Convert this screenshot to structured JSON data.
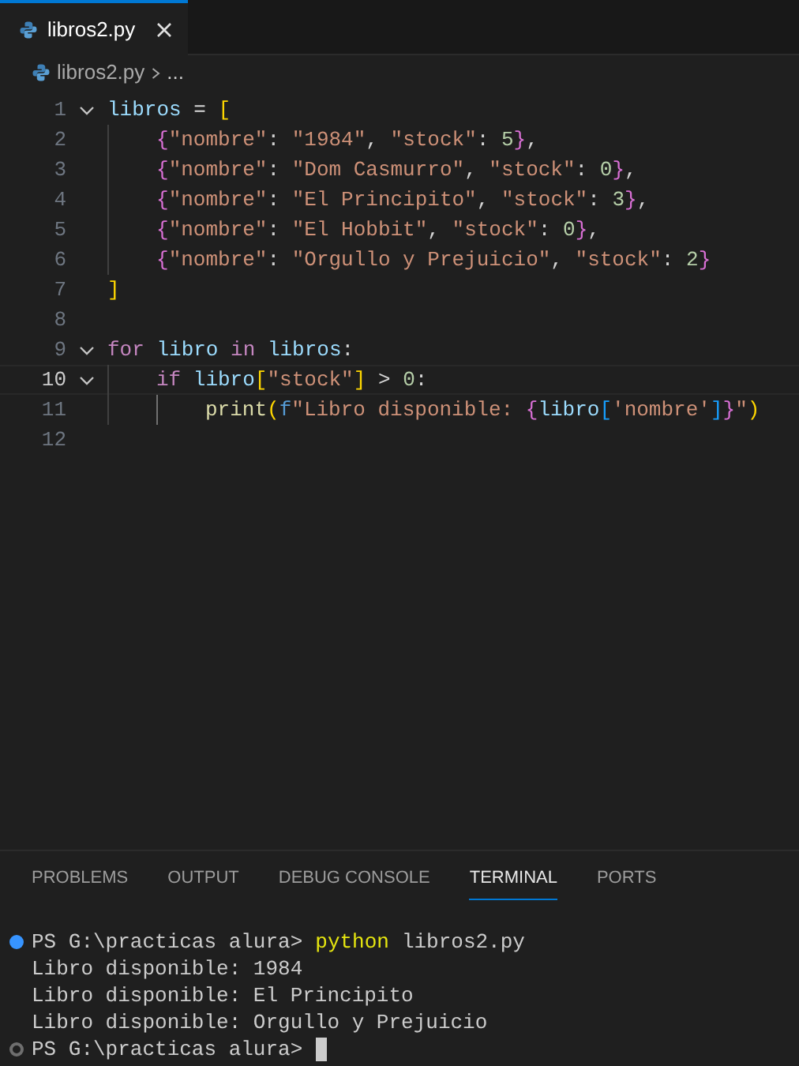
{
  "editor_tabs": [
    {
      "label": "libros2.py",
      "selected": true
    }
  ],
  "breadcrumb": {
    "file": "libros2.py",
    "symbol": "..."
  },
  "code_lines": [
    {
      "number": "1",
      "expanded": true,
      "tokens": [
        {
          "kind": "variable",
          "text": "libros"
        },
        {
          "kind": "operator",
          "text": " = "
        },
        {
          "kind": "bracket1",
          "text": "["
        }
      ],
      "children": [
        {
          "number": "2",
          "tokens": [
            {
              "kind": "bracket2",
              "text": "{"
            },
            {
              "kind": "string",
              "text": "\"nombre\""
            },
            {
              "kind": "operator",
              "text": ": "
            },
            {
              "kind": "string",
              "text": "\"1984\""
            },
            {
              "kind": "operator",
              "text": ", "
            },
            {
              "kind": "string",
              "text": "\"stock\""
            },
            {
              "kind": "operator",
              "text": ": "
            },
            {
              "kind": "number",
              "text": "5"
            },
            {
              "kind": "bracket2",
              "text": "}"
            },
            {
              "kind": "operator",
              "text": ","
            }
          ]
        },
        {
          "number": "3",
          "tokens": [
            {
              "kind": "bracket2",
              "text": "{"
            },
            {
              "kind": "string",
              "text": "\"nombre\""
            },
            {
              "kind": "operator",
              "text": ": "
            },
            {
              "kind": "string",
              "text": "\"Dom Casmurro\""
            },
            {
              "kind": "operator",
              "text": ", "
            },
            {
              "kind": "string",
              "text": "\"stock\""
            },
            {
              "kind": "operator",
              "text": ": "
            },
            {
              "kind": "number",
              "text": "0"
            },
            {
              "kind": "bracket2",
              "text": "}"
            },
            {
              "kind": "operator",
              "text": ","
            }
          ]
        },
        {
          "number": "4",
          "tokens": [
            {
              "kind": "bracket2",
              "text": "{"
            },
            {
              "kind": "string",
              "text": "\"nombre\""
            },
            {
              "kind": "operator",
              "text": ": "
            },
            {
              "kind": "string",
              "text": "\"El Principito\""
            },
            {
              "kind": "operator",
              "text": ", "
            },
            {
              "kind": "string",
              "text": "\"stock\""
            },
            {
              "kind": "operator",
              "text": ": "
            },
            {
              "kind": "number",
              "text": "3"
            },
            {
              "kind": "bracket2",
              "text": "}"
            },
            {
              "kind": "operator",
              "text": ","
            }
          ]
        },
        {
          "number": "5",
          "tokens": [
            {
              "kind": "bracket2",
              "text": "{"
            },
            {
              "kind": "string",
              "text": "\"nombre\""
            },
            {
              "kind": "operator",
              "text": ": "
            },
            {
              "kind": "string",
              "text": "\"El Hobbit\""
            },
            {
              "kind": "operator",
              "text": ", "
            },
            {
              "kind": "string",
              "text": "\"stock\""
            },
            {
              "kind": "operator",
              "text": ": "
            },
            {
              "kind": "number",
              "text": "0"
            },
            {
              "kind": "bracket2",
              "text": "}"
            },
            {
              "kind": "operator",
              "text": ","
            }
          ]
        },
        {
          "number": "6",
          "tokens": [
            {
              "kind": "bracket2",
              "text": "{"
            },
            {
              "kind": "string",
              "text": "\"nombre\""
            },
            {
              "kind": "operator",
              "text": ": "
            },
            {
              "kind": "string",
              "text": "\"Orgullo y Prejuicio\""
            },
            {
              "kind": "operator",
              "text": ", "
            },
            {
              "kind": "string",
              "text": "\"stock\""
            },
            {
              "kind": "operator",
              "text": ": "
            },
            {
              "kind": "number",
              "text": "2"
            },
            {
              "kind": "bracket2",
              "text": "}"
            }
          ]
        }
      ]
    },
    {
      "number": "7",
      "tokens": [
        {
          "kind": "bracket1",
          "text": "]"
        }
      ]
    },
    {
      "number": "8"
    },
    {
      "number": "9",
      "expanded": true,
      "tokens": [
        {
          "kind": "keyword",
          "text": "for "
        },
        {
          "kind": "variable",
          "text": "libro "
        },
        {
          "kind": "keyword",
          "text": "in "
        },
        {
          "kind": "variable",
          "text": "libros"
        },
        {
          "kind": "operator",
          "text": ":"
        }
      ],
      "children": [
        {
          "number": "10",
          "expanded": true,
          "current": true,
          "tokens": [
            {
              "kind": "keyword",
              "text": "if "
            },
            {
              "kind": "variable",
              "text": "libro"
            },
            {
              "kind": "bracket1",
              "text": "["
            },
            {
              "kind": "string",
              "text": "\"stock\""
            },
            {
              "kind": "bracket1",
              "text": "]"
            },
            {
              "kind": "operator",
              "text": " > "
            },
            {
              "kind": "number",
              "text": "0"
            },
            {
              "kind": "operator",
              "text": ":"
            }
          ],
          "children": [
            {
              "number": "11",
              "tokens": [
                {
                  "kind": "function",
                  "text": "print"
                },
                {
                  "kind": "bracket1",
                  "text": "("
                },
                {
                  "kind": "storage",
                  "text": "f"
                },
                {
                  "kind": "string",
                  "text": "\"Libro disponible: "
                },
                {
                  "kind": "bracket2",
                  "text": "{"
                },
                {
                  "kind": "variable",
                  "text": "libro"
                },
                {
                  "kind": "bracket3",
                  "text": "["
                },
                {
                  "kind": "string",
                  "text": "'nombre'"
                },
                {
                  "kind": "bracket3",
                  "text": "]"
                },
                {
                  "kind": "bracket2",
                  "text": "}"
                },
                {
                  "kind": "string",
                  "text": "\""
                },
                {
                  "kind": "bracket1",
                  "text": ")"
                }
              ]
            }
          ]
        }
      ]
    },
    {
      "number": "12"
    }
  ],
  "panel_tabs": [
    {
      "label": "PROBLEMS",
      "selected": false
    },
    {
      "label": "OUTPUT",
      "selected": false
    },
    {
      "label": "DEBUG CONSOLE",
      "selected": false
    },
    {
      "label": "TERMINAL",
      "selected": true
    },
    {
      "label": "PORTS",
      "selected": false
    }
  ],
  "terminal_lines": [
    {
      "kind": "prompt",
      "succeeded": true,
      "prompt": "PS G:\\practicas alura>",
      "command": "python",
      "args": "libros2.py"
    },
    {
      "kind": "output",
      "text": "Libro disponible: 1984"
    },
    {
      "kind": "output",
      "text": "Libro disponible: El Principito"
    },
    {
      "kind": "output",
      "text": "Libro disponible: Orgullo y Prejuicio"
    },
    {
      "kind": "prompt",
      "succeeded": false,
      "prompt": "PS G:\\practicas alura>",
      "cursor": true
    }
  ]
}
